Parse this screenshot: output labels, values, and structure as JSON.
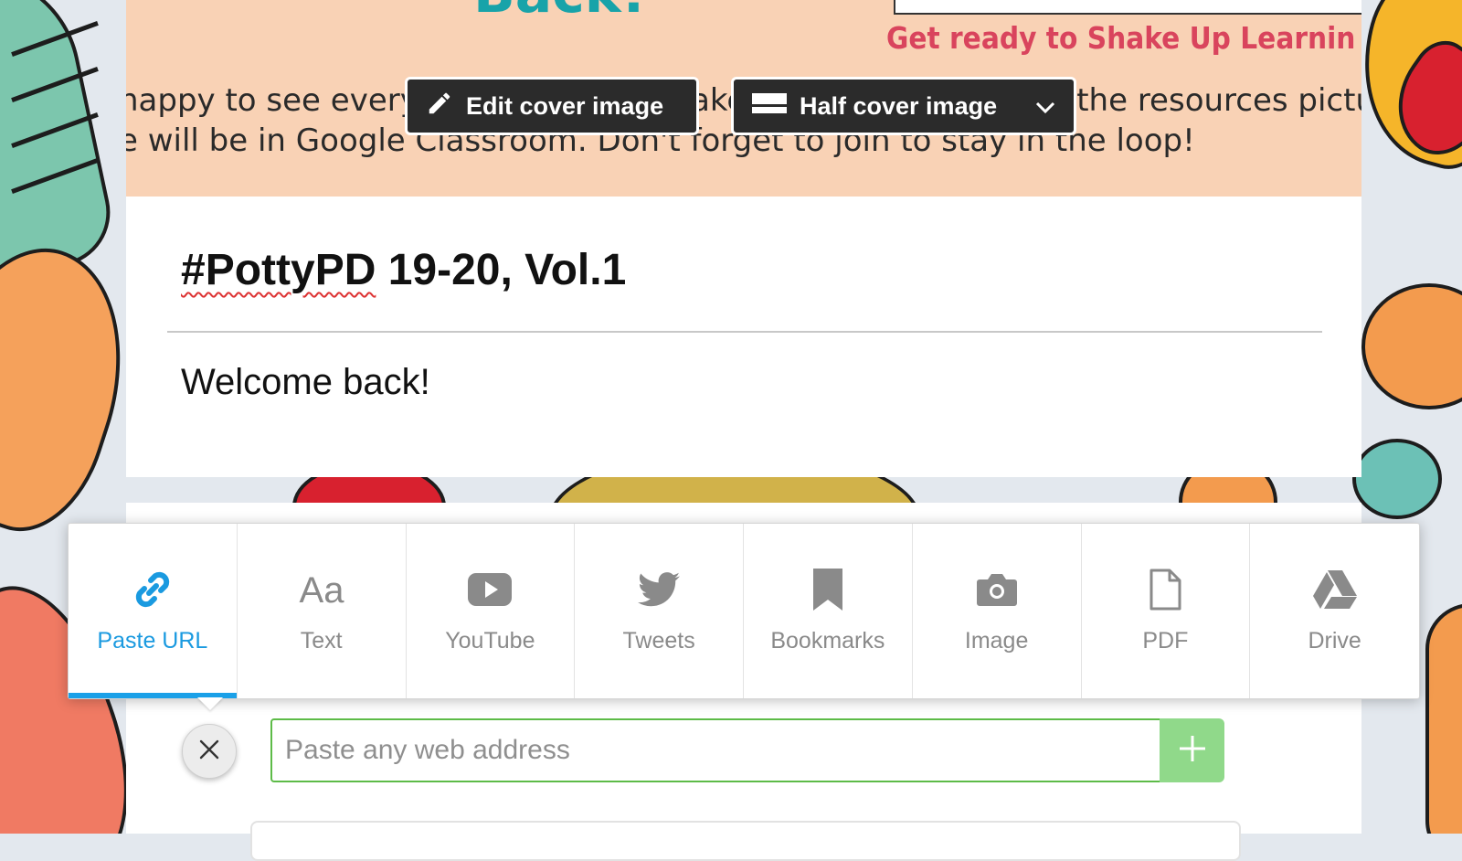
{
  "cover": {
    "title_fragment": "Back!",
    "tagline": "Get ready to Shake Up Learnin",
    "text_line_1": "happy to see everyone again! The Wakelet collection with all the resources pictu",
    "text_line_2": "e will be in Google Classroom. Don't forget to join to stay in the loop!",
    "edit_button_label": "Edit cover image",
    "layout_button_label": "Half cover image"
  },
  "collection": {
    "title_prefix": "#PottyPD",
    "title_suffix": " 19-20, Vol.1",
    "description": "Welcome back!"
  },
  "toolbar": {
    "active_tab": "Paste URL",
    "tabs": [
      {
        "label": "Paste URL",
        "icon": "link-icon"
      },
      {
        "label": "Text",
        "icon": "text-aa-icon"
      },
      {
        "label": "YouTube",
        "icon": "youtube-icon"
      },
      {
        "label": "Tweets",
        "icon": "twitter-icon"
      },
      {
        "label": "Bookmarks",
        "icon": "bookmark-icon"
      },
      {
        "label": "Image",
        "icon": "camera-icon"
      },
      {
        "label": "PDF",
        "icon": "file-icon"
      },
      {
        "label": "Drive",
        "icon": "drive-icon"
      }
    ]
  },
  "url_entry": {
    "placeholder": "Paste any web address",
    "value": ""
  },
  "colors": {
    "accent": "#1a9ae0",
    "input_border": "#5dbb48",
    "add_button": "#90d98a",
    "cover_bg": "#f9d2b5",
    "cover_button_bg": "#2b2b2b"
  }
}
